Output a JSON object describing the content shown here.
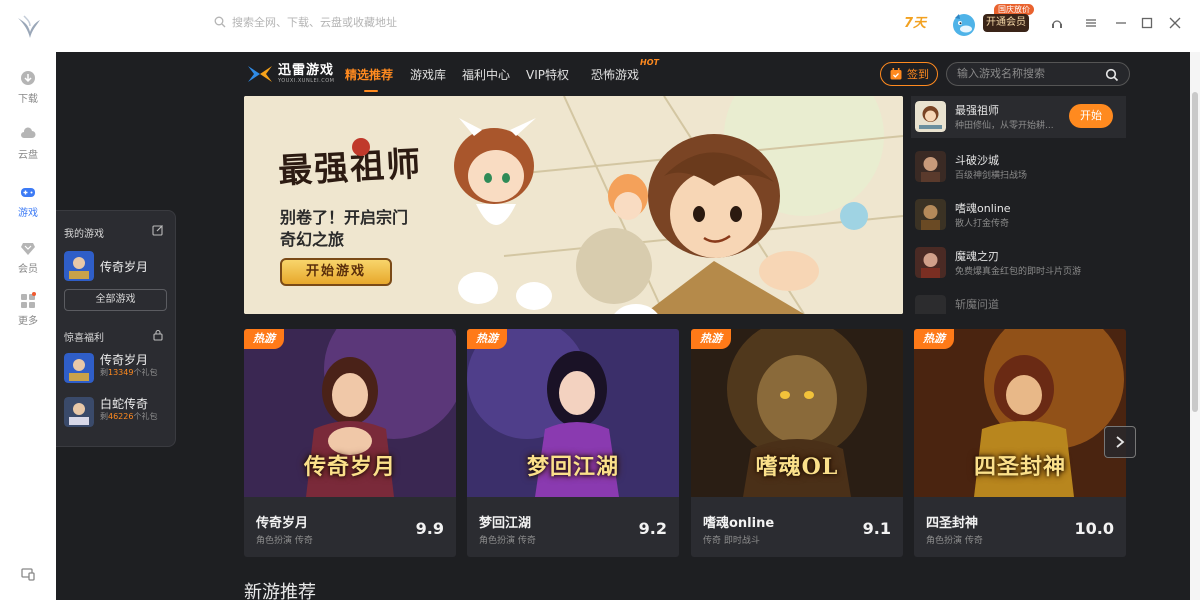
{
  "titlebar": {
    "search_placeholder": "搜索全网、下载、云盘或收藏地址",
    "checkin_badge": "7天",
    "promo_tag": "国庆放价",
    "vip_button": "开通会员"
  },
  "rail": {
    "items": [
      {
        "label": "下载",
        "icon": "download-icon"
      },
      {
        "label": "云盘",
        "icon": "cloud-icon"
      },
      {
        "label": "游戏",
        "icon": "gamepad-icon",
        "active": true
      },
      {
        "label": "会员",
        "icon": "diamond-icon"
      },
      {
        "label": "更多",
        "icon": "grid-icon"
      }
    ]
  },
  "game_nav": {
    "brand_name": "迅雷游戏",
    "brand_sub": "YOUXI.XUNLEI.COM",
    "tabs": [
      "精选推荐",
      "游戏库",
      "福利中心",
      "VIP特权",
      "恐怖游戏"
    ],
    "hot_tag": "HOT",
    "sign_label": "签到",
    "search_placeholder": "输入游戏名称搜索"
  },
  "hero": {
    "title": "最强祖师",
    "line1": "别卷了！开启宗门",
    "line2": "奇幻之旅",
    "cta": "开始游戏"
  },
  "side_list": [
    {
      "name": "最强祖师",
      "desc": "种田修仙，从零开始耕...",
      "action": "开始"
    },
    {
      "name": "斗破沙城",
      "desc": "百级神剑横扫战场"
    },
    {
      "name": "嗜魂online",
      "desc": "散人打金传奇"
    },
    {
      "name": "魔魂之刃",
      "desc": "免费爆真金红包的即时斗片页游"
    },
    {
      "name": "斩魔问道",
      "desc": ""
    }
  ],
  "cards": [
    {
      "hot": "热游",
      "name": "传奇岁月",
      "tags": "角色扮演  传奇",
      "score": "9.9",
      "art_logo": "传奇岁月"
    },
    {
      "hot": "热游",
      "name": "梦回江湖",
      "tags": "角色扮演  传奇",
      "score": "9.2",
      "art_logo": "梦回江湖"
    },
    {
      "hot": "热游",
      "name": "嗜魂online",
      "tags": "传奇  即时战斗",
      "score": "9.1",
      "art_logo": "嗜魂OL"
    },
    {
      "hot": "热游",
      "name": "四圣封神",
      "tags": "角色扮演  传奇",
      "score": "10.0",
      "art_logo": "四圣封神"
    }
  ],
  "section_title": "新游推荐",
  "my_games": {
    "header": "我的游戏",
    "game": "传奇岁月",
    "all_button": "全部游戏",
    "gifts_header": "惊喜福利",
    "gifts": [
      {
        "name": "传奇岁月",
        "prefix": "剩",
        "count": "13349",
        "suffix": "个礼包"
      },
      {
        "name": "白蛇传奇",
        "prefix": "剩",
        "count": "46226",
        "suffix": "个礼包"
      }
    ]
  },
  "colors": {
    "accent": "#ff8a1f",
    "rail_active": "#3d7bf5",
    "main_bg": "#1e1f22"
  }
}
